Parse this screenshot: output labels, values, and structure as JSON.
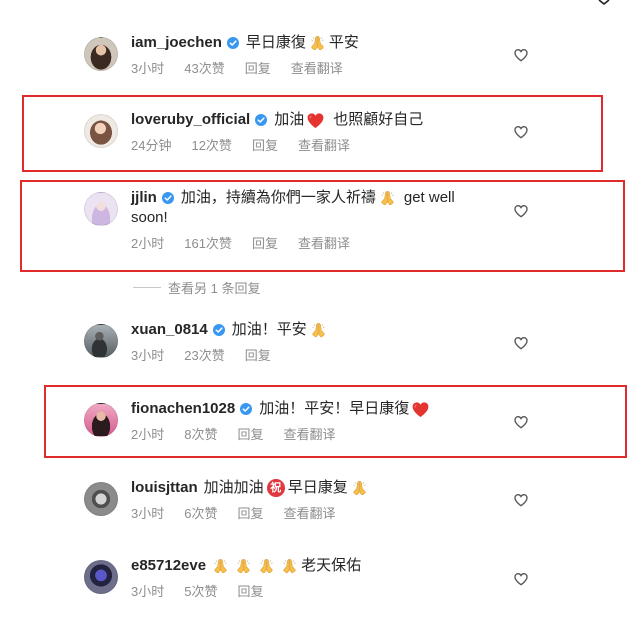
{
  "comments": [
    {
      "username": "iam_joechen",
      "verified": true,
      "content": [
        {
          "text": "早日康復"
        },
        {
          "icon": "pray-emoji"
        },
        {
          "text": "平安"
        }
      ],
      "time": "3小时",
      "likes": "43次赞",
      "reply": "回复",
      "translate": "查看翻译",
      "highlighted": false
    },
    {
      "username": "loveruby_official",
      "verified": true,
      "content": [
        {
          "text": "加油"
        },
        {
          "icon": "red-heart-emoji"
        },
        {
          "text": "也照顧好自己"
        }
      ],
      "time": "24分钟",
      "likes": "12次赞",
      "reply": "回复",
      "translate": "查看翻译",
      "highlighted": true
    },
    {
      "username": "jjlin",
      "verified": true,
      "content": [
        {
          "text": "加油，持續為你們一家人祈禱"
        },
        {
          "icon": "pray-emoji"
        },
        {
          "text": "get well"
        },
        {
          "text": "soon!"
        }
      ],
      "time": "2小时",
      "likes": "161次赞",
      "reply": "回复",
      "translate": "查看翻译",
      "view_replies": "查看另 1 条回复",
      "highlighted": true
    },
    {
      "username": "xuan_0814",
      "verified": true,
      "content": [
        {
          "text": "加油！平安"
        },
        {
          "icon": "pray-emoji"
        }
      ],
      "time": "3小时",
      "likes": "23次赞",
      "reply": "回复",
      "highlighted": false
    },
    {
      "username": "fionachen1028",
      "verified": true,
      "content": [
        {
          "text": "加油！平安！早日康復"
        },
        {
          "icon": "red-heart-emoji"
        }
      ],
      "time": "2小时",
      "likes": "8次赞",
      "reply": "回复",
      "translate": "查看翻译",
      "highlighted": true
    },
    {
      "username": "louisjttan",
      "verified": false,
      "content": [
        {
          "text": "加油加油"
        },
        {
          "icon": "congratulations-emoji",
          "text": "祝"
        },
        {
          "text": "早日康复"
        },
        {
          "icon": "pray-emoji"
        }
      ],
      "time": "3小时",
      "likes": "6次赞",
      "reply": "回复",
      "translate": "查看翻译",
      "highlighted": false
    },
    {
      "username": "e85712eve",
      "verified": false,
      "content": [
        {
          "icon": "pray-emoji"
        },
        {
          "icon": "pray-emoji"
        },
        {
          "icon": "pray-emoji"
        },
        {
          "icon": "pray-emoji"
        },
        {
          "text": "老天保佑"
        }
      ],
      "time": "3小时",
      "likes": "5次赞",
      "reply": "回复",
      "highlighted": false
    }
  ],
  "colors": {
    "text": "#262626",
    "meta": "#8e8e8e",
    "verified_badge": "#3897f0",
    "highlight_box": "#df2b2b",
    "heart_emoji": "#e3342f"
  }
}
